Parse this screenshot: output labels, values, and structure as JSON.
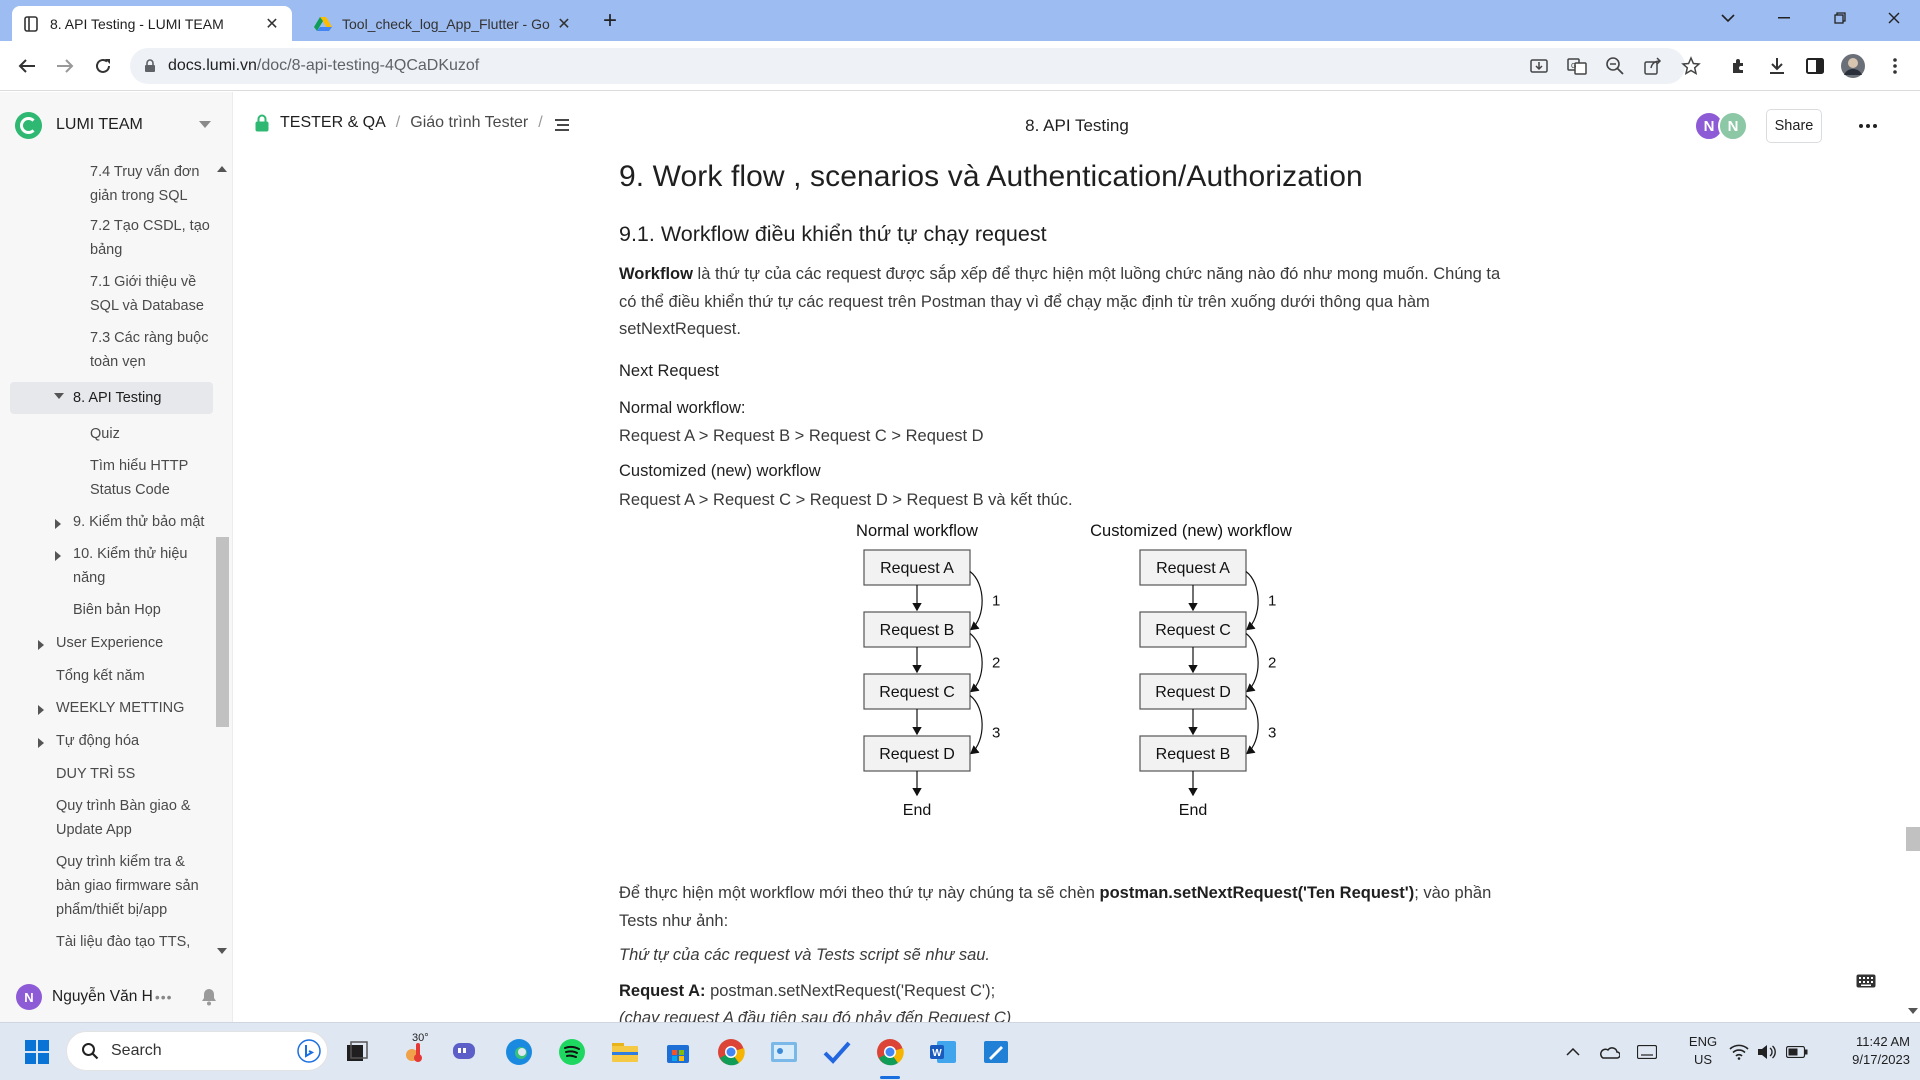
{
  "browser": {
    "tabs": [
      {
        "title": "8. API Testing - LUMI TEAM",
        "active": true
      },
      {
        "title": "Tool_check_log_App_Flutter - Go",
        "active": false
      }
    ],
    "url_host": "docs.lumi.vn",
    "url_path": "/doc/8-api-testing-4QCaDKuzof"
  },
  "sidebar": {
    "team_name": "LUMI TEAM",
    "items": [
      {
        "label": "7.4 Truy vấn đơn giản trong SQL",
        "indent": 2,
        "arrow": "none"
      },
      {
        "label": "7.2 Tạo CSDL, tạo bảng",
        "indent": 2,
        "arrow": "none"
      },
      {
        "label": "7.1 Giới thiệu về SQL và Database",
        "indent": 2,
        "arrow": "none"
      },
      {
        "label": "7.3 Các ràng buộc toàn vẹn",
        "indent": 2,
        "arrow": "none"
      },
      {
        "label": "8. API Testing",
        "indent": 1,
        "arrow": "down",
        "selected": true
      },
      {
        "label": "Quiz",
        "indent": 2,
        "arrow": "none"
      },
      {
        "label": "Tìm hiểu HTTP Status Code",
        "indent": 2,
        "arrow": "none"
      },
      {
        "label": "9. Kiểm thử bảo mật",
        "indent": 1,
        "arrow": "right"
      },
      {
        "label": "10. Kiểm thử hiệu năng",
        "indent": 1,
        "arrow": "right"
      },
      {
        "label": "Biên bản Họp",
        "indent": 1,
        "arrow": "none"
      },
      {
        "label": "User Experience",
        "indent": 0,
        "arrow": "right"
      },
      {
        "label": "Tổng kết năm",
        "indent": 0,
        "arrow": "none"
      },
      {
        "label": "WEEKLY METTING",
        "indent": 0,
        "arrow": "right"
      },
      {
        "label": "Tự động hóa",
        "indent": 0,
        "arrow": "right"
      },
      {
        "label": "DUY TRÌ 5S",
        "indent": 0,
        "arrow": "none"
      },
      {
        "label": "Quy trình Bàn giao & Update App",
        "indent": 0,
        "arrow": "none"
      },
      {
        "label": "Quy trình kiểm tra & bàn giao firmware sản phẩm/thiết bị/app",
        "indent": 0,
        "arrow": "none"
      },
      {
        "label": "Tài liệu đào tạo TTS,",
        "indent": 0,
        "arrow": "none"
      }
    ],
    "user_initial": "N",
    "user_name": "Nguyễn Văn H",
    "user_more": "•••"
  },
  "doc_header": {
    "crumb_1": "TESTER & QA",
    "crumb_sep": "/",
    "crumb_2": "Giáo trình Tester",
    "title": "8. API Testing",
    "avatar_1": "N",
    "avatar_2": "N",
    "share_label": "Share"
  },
  "doc": {
    "h1": "9. Work flow , scenarios và Authentication/Authorization",
    "h2": "9.1. Workflow điều khiển thứ tự chạy request",
    "intro_bold": "Workflow",
    "intro_rest": " là thứ tự của các request được sắp xếp để thực hiện một luồng chức năng nào đó như mong muốn. Chúng ta có thể điều khiển thứ tự các request trên Postman thay vì để chạy mặc định từ trên xuống dưới thông qua hàm setNextRequest.",
    "next_request": "Next Request",
    "normal_label": "Normal workflow:",
    "normal_seq": "Request A > Request B > Request C > Request D",
    "custom_label": "Customized (new) workflow",
    "custom_seq": "Request A > Request C > Request D > Request B và kết thúc.",
    "after_1": "Để thực hiện một workflow mới theo thứ tự này chúng ta sẽ chèn ",
    "after_code": "postman.setNextRequest('Ten Request')",
    "after_2": "; vào phần Tests như ảnh:",
    "order_line": "Thứ tự của các request và Tests script sẽ như sau.",
    "reqA_label": "Request A:",
    "reqA_code": " postman.setNextRequest('Request C');",
    "reqA_note": "(chạy request A đầu tiên sau đó nhảy đến Request C)"
  },
  "diagram": {
    "normal_title": "Normal workflow",
    "custom_title": "Customized (new) workflow",
    "normal_boxes": [
      "Request A",
      "Request B",
      "Request C",
      "Request D"
    ],
    "custom_boxes": [
      "Request A",
      "Request C",
      "Request D",
      "Request B"
    ],
    "step_labels": [
      "1",
      "2",
      "3"
    ],
    "end_label": "End"
  },
  "taskbar": {
    "search_label": "Search",
    "weather_temp": "30°",
    "lang_1": "ENG",
    "lang_2": "US",
    "time": "11:42 AM",
    "date": "9/17/2023"
  }
}
